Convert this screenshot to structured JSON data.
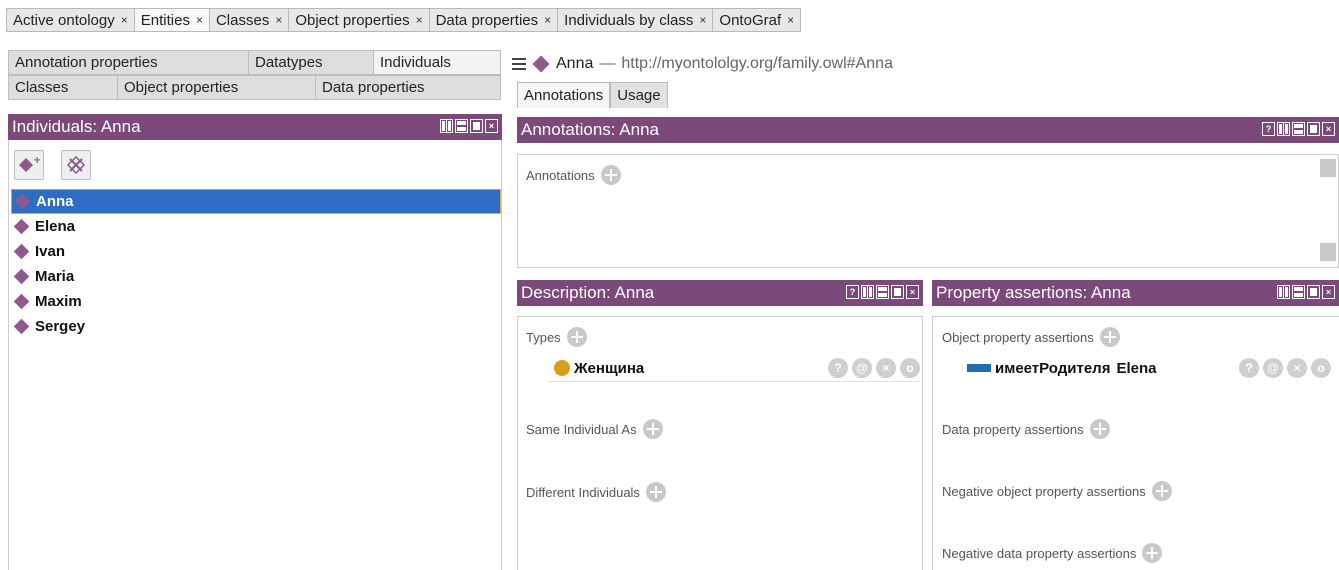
{
  "top_tabs": [
    {
      "label": "Active ontology",
      "close": "×"
    },
    {
      "label": "Entities",
      "close": "×"
    },
    {
      "label": "Classes",
      "close": "×"
    },
    {
      "label": "Object properties",
      "close": "×"
    },
    {
      "label": "Data properties",
      "close": "×"
    },
    {
      "label": "Individuals by class",
      "close": "×"
    },
    {
      "label": "OntoGraf",
      "close": "×"
    }
  ],
  "entity_tabs_row1": [
    "Annotation properties",
    "Datatypes",
    "Individuals"
  ],
  "entity_tabs_row2": [
    "Classes",
    "Object properties",
    "Data properties"
  ],
  "left_panel": {
    "title": "Individuals: Anna",
    "items": [
      "Anna",
      "Elena",
      "Ivan",
      "Maria",
      "Maxim",
      "Sergey"
    ],
    "selected": "Anna"
  },
  "entity_header": {
    "name": "Anna",
    "separator": "—",
    "iri": "http://myontololgy.org/family.owl#Anna"
  },
  "right_tabs": [
    "Annotations",
    "Usage"
  ],
  "annotations_panel": {
    "title": "Annotations: Anna",
    "label": "Annotations"
  },
  "description_panel": {
    "title": "Description: Anna",
    "types_label": "Types",
    "types_items": [
      "Женщина"
    ],
    "same_label": "Same Individual As",
    "different_label": "Different Individuals"
  },
  "property_panel": {
    "title": "Property assertions: Anna",
    "object_label": "Object property assertions",
    "object_items": [
      {
        "property": "имеетРодителя",
        "value": "Elena"
      }
    ],
    "data_label": "Data property assertions",
    "neg_object_label": "Negative object property assertions",
    "neg_data_label": "Negative data property assertions"
  },
  "row_buttons": [
    "?",
    "@",
    "×",
    "o"
  ],
  "colors": {
    "panel_header": "#7b4a7b",
    "selection": "#2f6cc4",
    "individual_icon": "#8e5a8e",
    "class_icon": "#d4a017",
    "object_property_icon": "#1f6fb5"
  }
}
